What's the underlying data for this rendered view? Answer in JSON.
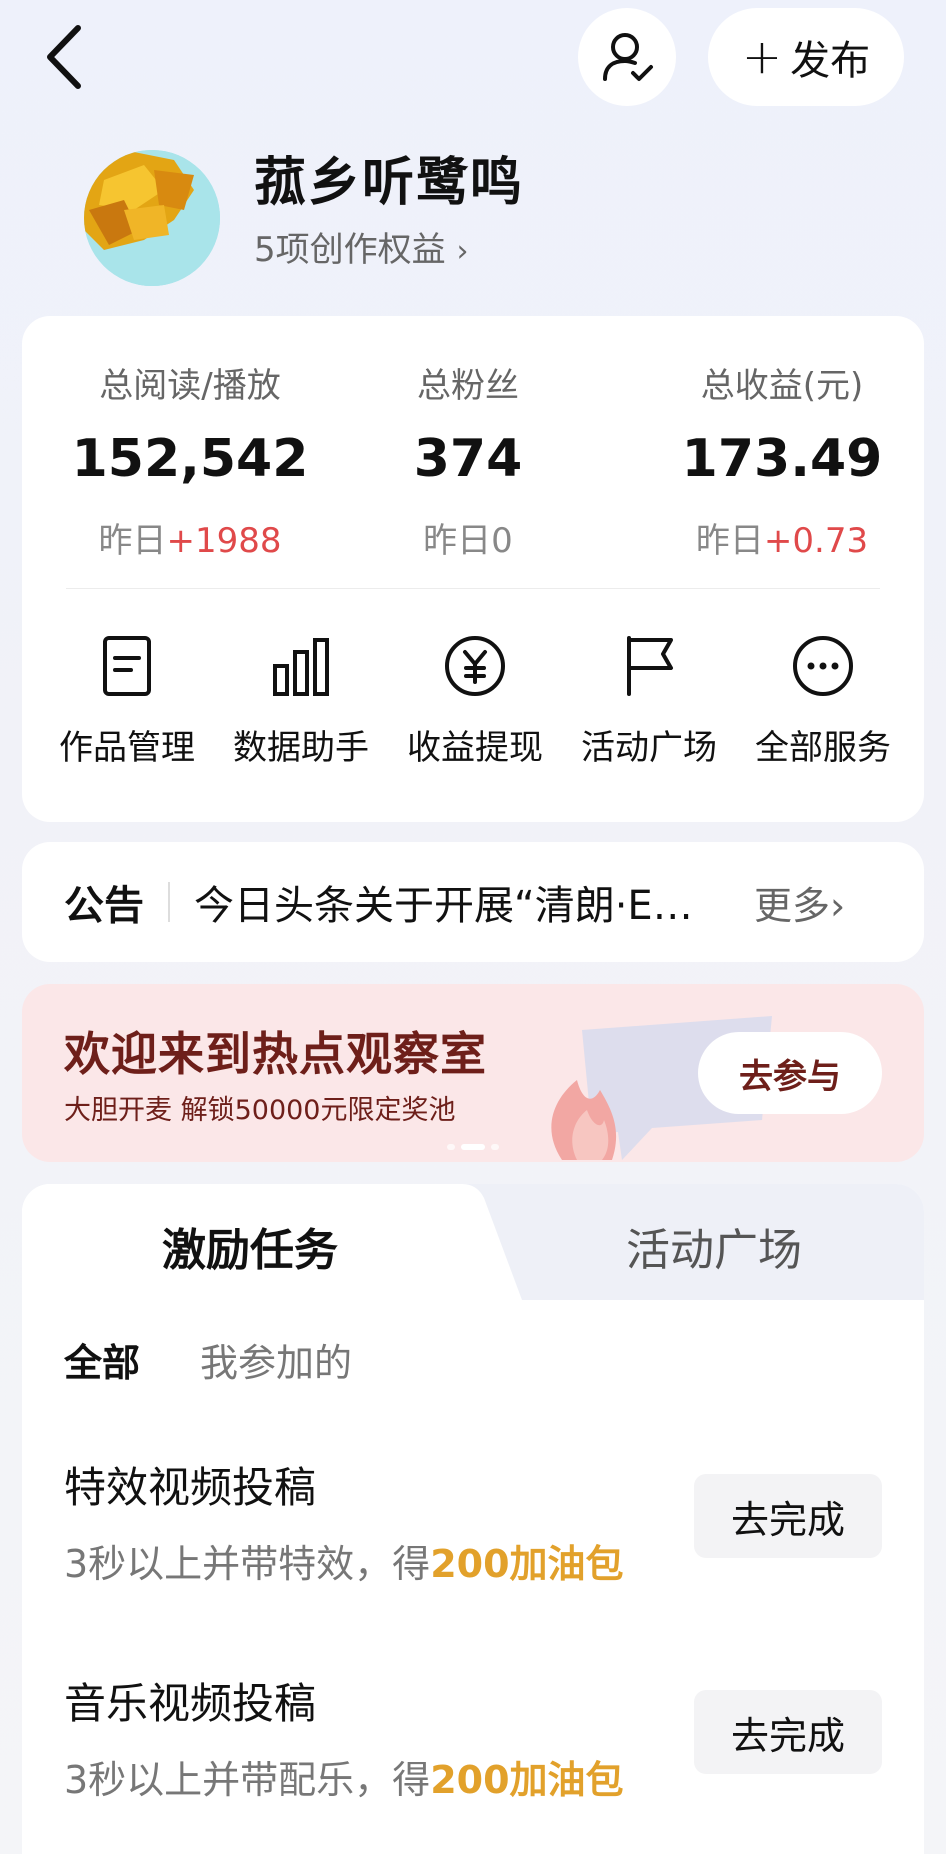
{
  "header": {
    "back_icon": "chevron-left-icon",
    "user_icon": "user-check-icon",
    "publish_label": "发布"
  },
  "profile": {
    "name": "菰乡听鹭鸣",
    "rights": "5项创作权益"
  },
  "stats": [
    {
      "label": "总阅读/播放",
      "value": "152,542",
      "delta_prefix": "昨日",
      "delta": "+1988",
      "delta_color": "#e0494a"
    },
    {
      "label": "总粉丝",
      "value": "374",
      "delta_prefix": "昨日",
      "delta": "0",
      "delta_color": "#888888"
    },
    {
      "label": "总收益(元)",
      "value": "173.49",
      "delta_prefix": "昨日",
      "delta": "+0.73",
      "delta_color": "#e0494a"
    }
  ],
  "services": [
    {
      "label": "作品管理",
      "icon": "document-icon"
    },
    {
      "label": "数据助手",
      "icon": "bar-chart-icon"
    },
    {
      "label": "收益提现",
      "icon": "yuan-icon"
    },
    {
      "label": "活动广场",
      "icon": "flag-icon"
    },
    {
      "label": "全部服务",
      "icon": "more-icon"
    }
  ],
  "notice": {
    "title": "公告",
    "text": "今日头条关于开展“清朗·E…",
    "more": "更多"
  },
  "banner": {
    "title": "欢迎来到热点观察室",
    "subtitle": "大胆开麦 解锁50000元限定奖池",
    "button": "去参与",
    "active_index": 1,
    "count": 3
  },
  "tasks": {
    "tabs": [
      "激励任务",
      "活动广场"
    ],
    "filters": [
      "全部",
      "我参加的"
    ],
    "items": [
      {
        "title": "特效视频投稿",
        "desc_prefix": "3秒以上并带特效，得",
        "reward": "200加油包",
        "button": "去完成"
      },
      {
        "title": "音乐视频投稿",
        "desc_prefix": "3秒以上并带配乐，得",
        "reward": "200加油包",
        "button": "去完成"
      }
    ]
  },
  "colors": {
    "accent_red": "#e0494a",
    "reward_gold": "#e2a12b",
    "banner_text": "#6e1f1a"
  }
}
